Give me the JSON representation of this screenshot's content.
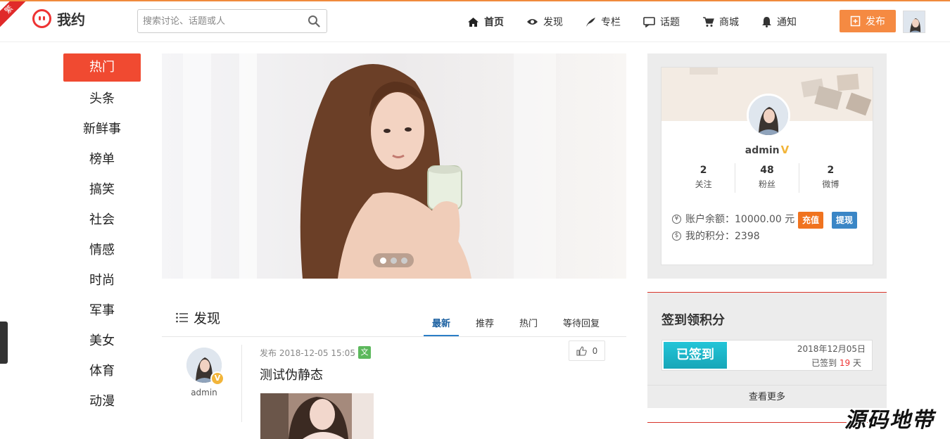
{
  "corner_badge": "繁",
  "logo": {
    "text": "我约"
  },
  "search": {
    "placeholder": "搜索讨论、话题或人"
  },
  "nav": {
    "items": [
      {
        "label": "首页",
        "icon": "home-icon"
      },
      {
        "label": "发现",
        "icon": "eye-icon"
      },
      {
        "label": "专栏",
        "icon": "feather-icon"
      },
      {
        "label": "话题",
        "icon": "chat-icon"
      },
      {
        "label": "商城",
        "icon": "cart-icon"
      },
      {
        "label": "通知",
        "icon": "bell-icon"
      }
    ],
    "publish_label": "发布"
  },
  "sidebar": {
    "categories": [
      "热门",
      "头条",
      "新鲜事",
      "榜单",
      "搞笑",
      "社会",
      "情感",
      "时尚",
      "军事",
      "美女",
      "体育",
      "动漫"
    ]
  },
  "feed": {
    "title": "发现",
    "tabs": [
      "最新",
      "推荐",
      "热门",
      "等待回复"
    ],
    "post": {
      "author": "admin",
      "meta": "发布 2018-12-05 15:05",
      "type_badge": "文",
      "title": "测试伪静态",
      "likes": "0"
    }
  },
  "profile": {
    "name": "admin",
    "stats": [
      {
        "n": "2",
        "l": "关注"
      },
      {
        "n": "48",
        "l": "粉丝"
      },
      {
        "n": "2",
        "l": "微博"
      }
    ],
    "balance": "账户余额：10000.00 元",
    "points": "我的积分：2398",
    "recharge_label": "充值",
    "withdraw_label": "提现"
  },
  "signin": {
    "title": "签到领积分",
    "signed_label": "已签到",
    "date": "2018年12月05日",
    "days_prefix": "已签到 ",
    "days": "19",
    "days_suffix": " 天",
    "more": "查看更多"
  },
  "watermark": "源码地带",
  "colors": {
    "accent": "#f04a31",
    "publish": "#f58a42",
    "signed": "#1bb5c8"
  }
}
